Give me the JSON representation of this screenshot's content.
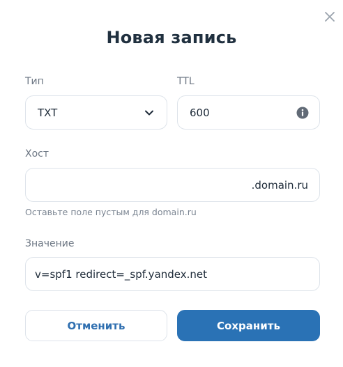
{
  "dialog": {
    "title": "Новая запись"
  },
  "type_field": {
    "label": "Тип",
    "value": "TXT"
  },
  "ttl_field": {
    "label": "TTL",
    "value": "600"
  },
  "host_field": {
    "label": "Хост",
    "value": "",
    "suffix": ".domain.ru",
    "hint": "Оставьте поле пустым для domain.ru"
  },
  "value_field": {
    "label": "Значение",
    "value": "v=spf1 redirect=_spf.yandex.net"
  },
  "buttons": {
    "cancel_label": "Отменить",
    "save_label": "Сохранить"
  },
  "icons": {
    "close": "close-icon",
    "dropdown": "chevron-down-icon",
    "info": "info-icon"
  },
  "colors": {
    "primary": "#2a72b5",
    "title": "#20303f",
    "label": "#6d7784",
    "border": "#dde3ea"
  }
}
